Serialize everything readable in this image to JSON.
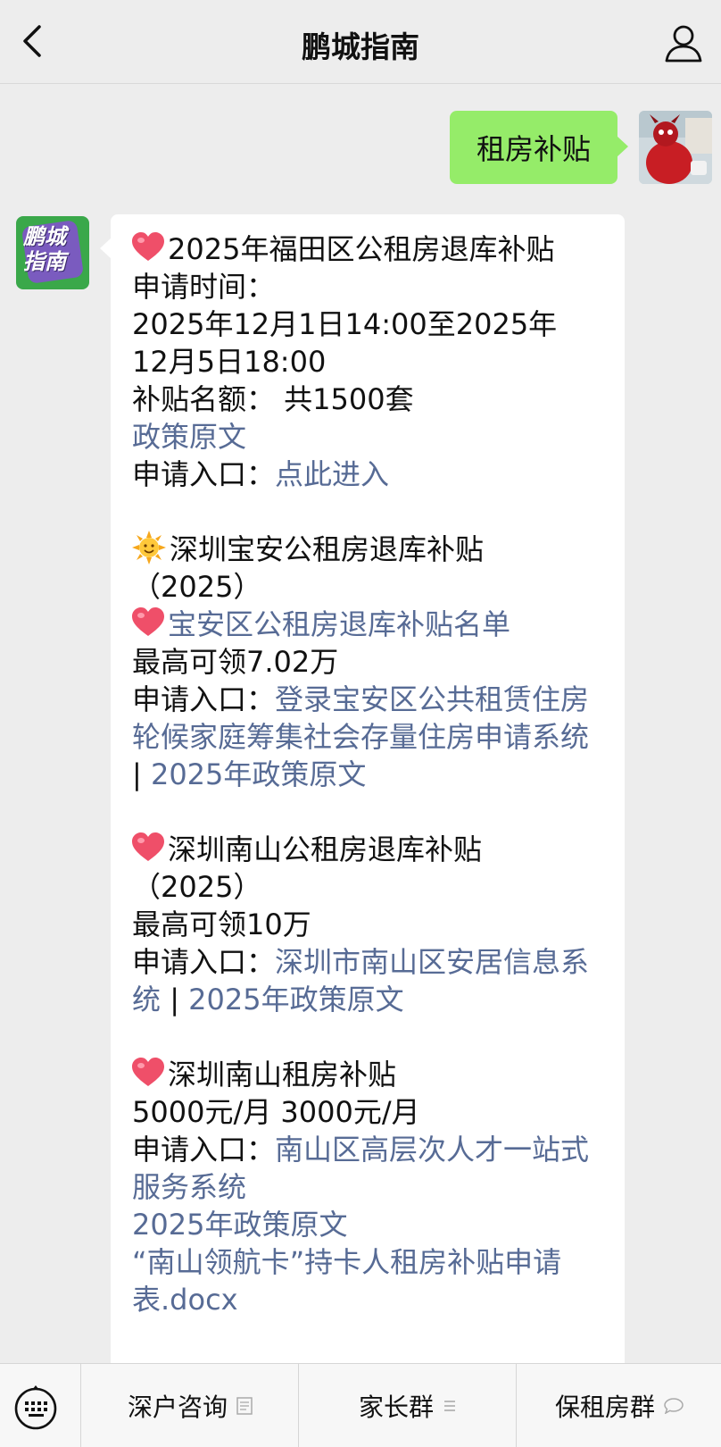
{
  "header": {
    "title": "鹏城指南"
  },
  "chat": {
    "user_message": "租房补贴",
    "bot_avatar_text": [
      "鹏城",
      "指南"
    ],
    "reply": {
      "s1": {
        "title": "2025年福田区公租房退库补贴",
        "time_label": "申请时间：",
        "time_line1": "2025年12月1日14:00至2025年",
        "time_line2": "12月5日18:00",
        "quota": "补贴名额：  共1500套",
        "policy_link": "政策原文",
        "entry_label": "申请入口：",
        "entry_link": "点此进入"
      },
      "s2": {
        "title_line1": "深圳宝安公租房退库补贴",
        "title_line2": "（2025）",
        "list_link": "宝安区公租房退库补贴名单",
        "max": "最高可领7.02万",
        "entry_label": "申请入口：",
        "entry_link": "登录宝安区公共租赁住房轮候家庭筹集社会存量住房申请系统",
        "sep": " | ",
        "policy_link": "2025年政策原文"
      },
      "s3": {
        "title_line1": "深圳南山公租房退库补贴",
        "title_line2": "（2025）",
        "max": "最高可领10万",
        "entry_label": "申请入口：",
        "entry_link": "深圳市南山区安居信息系统",
        "sep": " | ",
        "policy_link": "2025年政策原文"
      },
      "s4": {
        "title": "深圳南山租房补贴",
        "amount": "5000元/月  3000元/月",
        "entry_label": "申请入口：",
        "entry_link": "南山区高层次人才一站式服务系统",
        "policy_link": "2025年政策原文",
        "form_link": "“南山领航卡”持卡人租房补贴申请表.docx"
      }
    }
  },
  "bottom_menu": {
    "items": [
      {
        "label": "深户咨询",
        "icon": "page-icon"
      },
      {
        "label": "家长群",
        "icon": "menu-lines-icon"
      },
      {
        "label": "保租房群",
        "icon": "speech-bubble-icon"
      }
    ]
  },
  "colors": {
    "user_bubble": "#95ec69",
    "link": "#576b95",
    "background": "#ededed"
  }
}
